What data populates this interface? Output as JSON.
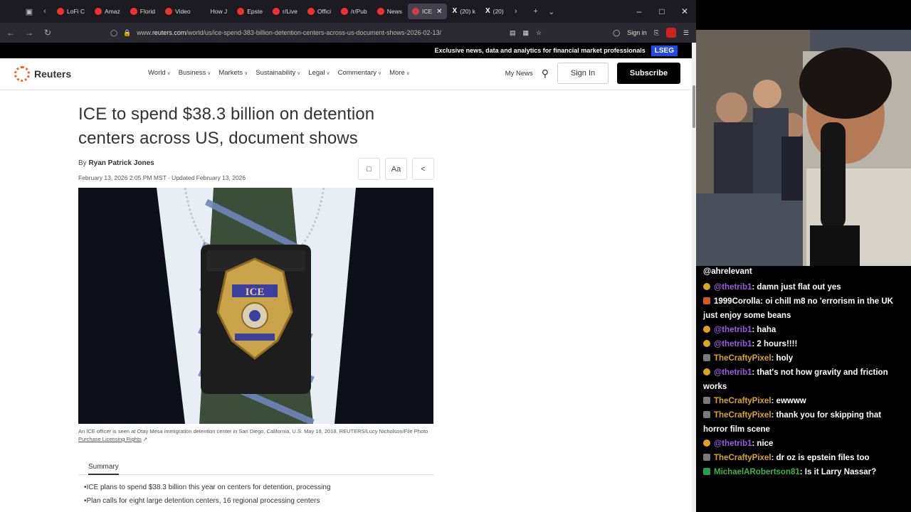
{
  "browser": {
    "tabs": [
      {
        "label": "LoFi C",
        "icon": "youtube-icon"
      },
      {
        "label": "Amaz",
        "icon": "youtube-icon"
      },
      {
        "label": "Florid",
        "icon": "youtube-icon"
      },
      {
        "label": "Video",
        "icon": "youtube-icon"
      },
      {
        "label": "How J",
        "icon": "page-icon"
      },
      {
        "label": "Epste",
        "icon": "youtube-icon"
      },
      {
        "label": "r/Live",
        "icon": "reddit-icon"
      },
      {
        "label": "Offici",
        "icon": "reddit-icon"
      },
      {
        "label": "/r/Pub",
        "icon": "reddit-icon"
      },
      {
        "label": "News",
        "icon": "reddit-icon"
      },
      {
        "label": "ICE",
        "icon": "reuters-icon",
        "active": true
      },
      {
        "label": "(20) k",
        "icon": "x-icon"
      },
      {
        "label": "(20)",
        "icon": "x-icon"
      }
    ],
    "url_prefix": "www.",
    "url_domain": "reuters.com",
    "url_path": "/world/us/ice-spend-383-billion-detention-centers-across-us-document-shows-2026-02-13/",
    "sign_in": "Sign in"
  },
  "site": {
    "promo_text": "Exclusive news, data and analytics for financial market professionals",
    "promo_badge": "LSEG",
    "logo": "Reuters",
    "nav": [
      "World",
      "Business",
      "Markets",
      "Sustainability",
      "Legal",
      "Commentary",
      "More"
    ],
    "my_news": "My News",
    "sign_in": "Sign In",
    "subscribe": "Subscribe"
  },
  "article": {
    "headline": "ICE to spend $38.3 billion on detention centers across US, document shows",
    "by": "By",
    "author": "Ryan Patrick Jones",
    "dateline": "February 13, 2026 2:05 PM MST · Updated February 13, 2026",
    "font_button": "Aa",
    "caption": "An ICE officer is seen at Otay Mesa immigration detention center in San Diego, California, U.S. May 18, 2018. REUTERS/Lucy Nicholson/File Photo",
    "licensing": "Purchase Licensing Rights",
    "badge_text": "ICE",
    "summary_title": "Summary",
    "summary": [
      "ICE plans to spend $38.3 billion this year on centers for detention, processing",
      "Plan calls for eight large detention centers, 16 regional processing centers"
    ]
  },
  "chat": {
    "top_user": "@ahrelevant",
    "messages": [
      {
        "user": "@thetrib1",
        "text": ": damn just flat out yes",
        "color": "purple",
        "badge": "gold"
      },
      {
        "user": "1999Corolla",
        "text": ": oi chill m8 no 'errorism in the UK just enjoy some beans",
        "color": "white",
        "badge": "orange"
      },
      {
        "user": "@thetrib1",
        "text": ": haha",
        "color": "purple",
        "badge": "gold"
      },
      {
        "user": "@thetrib1",
        "text": ": 2 hours!!!!",
        "color": "purple",
        "badge": "gold"
      },
      {
        "user": "TheCraftyPixel",
        "text": ": holy",
        "color": "gold",
        "badge": "mod"
      },
      {
        "user": "@thetrib1",
        "text": ": that's not how gravity and friction works",
        "color": "purple",
        "badge": "gold"
      },
      {
        "user": "TheCraftyPixel",
        "text": ": ewwww",
        "color": "gold",
        "badge": "mod"
      },
      {
        "user": "TheCraftyPixel",
        "text": ": thank you for skipping that horror film scene",
        "color": "gold",
        "badge": "mod"
      },
      {
        "user": "@thetrib1",
        "text": ": nice",
        "color": "purple",
        "badge": "gold"
      },
      {
        "user": "TheCraftyPixel",
        "text": ": dr oz is epstein files too",
        "color": "gold",
        "badge": "mod"
      },
      {
        "user": "MichaelARobertson81",
        "text": ": Is it Larry Nassar?",
        "color": "green",
        "badge": "green"
      }
    ]
  }
}
